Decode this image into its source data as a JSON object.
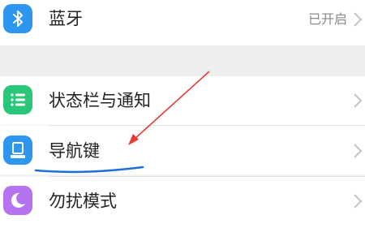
{
  "settings": {
    "bluetooth": {
      "label": "蓝牙",
      "value": "已开启",
      "icon": "bluetooth-icon",
      "icon_color": "#2f96f0"
    },
    "status_bar": {
      "label": "状态栏与通知",
      "icon": "status-bar-icon",
      "icon_color": "#28c77a"
    },
    "nav_keys": {
      "label": "导航键",
      "icon": "navigation-key-icon",
      "icon_color": "#2f96f0"
    },
    "dnd": {
      "label": "勿扰模式",
      "icon": "moon-icon",
      "icon_color": "#b673f0"
    }
  },
  "annotation": {
    "arrow_color": "#e53935",
    "underline_color": "#1e6fd9"
  }
}
